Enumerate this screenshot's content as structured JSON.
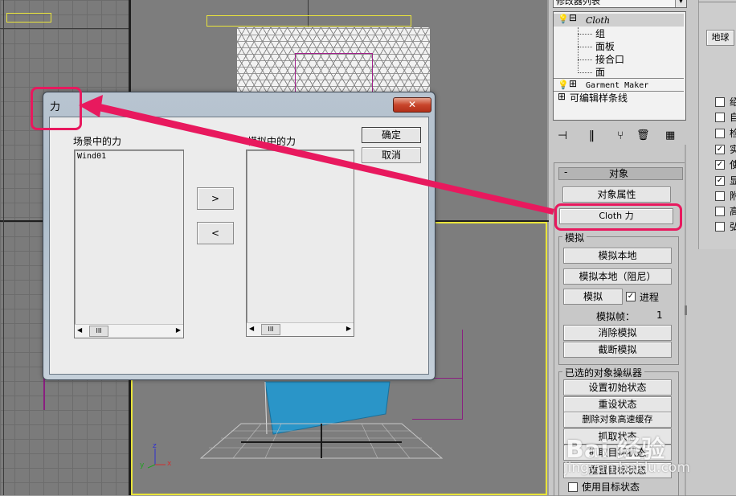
{
  "dialog": {
    "title": "力",
    "scene_forces_label": "场景中的力",
    "sim_forces_label": "模拟中的力",
    "scene_forces": [
      "Wind01"
    ],
    "add_label": ">",
    "remove_label": "<",
    "ok_label": "确定",
    "cancel_label": "取消",
    "close_glyph": "✕",
    "scroll_thumb": "III"
  },
  "panel": {
    "modifier_list": "修改器列表",
    "stack": [
      {
        "label": "Cloth",
        "level": 0,
        "expand": "⊟"
      },
      {
        "label": "组",
        "level": 1
      },
      {
        "label": "面板",
        "level": 1
      },
      {
        "label": "接合口",
        "level": 1
      },
      {
        "label": "面",
        "level": 1
      },
      {
        "label": "Garment Maker",
        "level": 0,
        "expand": "⊞"
      },
      {
        "label": "可编辑样条线",
        "level": 0,
        "expand": "⊞"
      }
    ],
    "rollout_title": "对象",
    "rollout_collapse": "-",
    "object_props": "对象属性",
    "cloth_forces": "Cloth 力",
    "sim_group": "模拟",
    "sim_local": "模拟本地",
    "sim_local_damped": "模拟本地（阻尼）",
    "simulate": "模拟",
    "progress": "进程",
    "sim_frame_label": "模拟帧：",
    "sim_frame_value": "1",
    "erase_sim": "消除模拟",
    "truncate_sim": "截断模拟",
    "selected_group": "已选的对象操纵器",
    "set_initial": "设置初始状态",
    "reset_state": "重设状态",
    "delete_cache": "删除对象高速缓存",
    "grab_state": "抓取状态",
    "grab_target": "抓取目标状态",
    "reset_target": "重置目标状态",
    "use_target": "使用目标状态",
    "far_right_button": "地球",
    "far_right_checks": [
      "绍",
      "自",
      "检",
      "实",
      "使",
      "显",
      "附",
      "高",
      "弘"
    ]
  },
  "watermark": {
    "brand": "Bai 经验",
    "url": "jingyan.baidu.com"
  },
  "axis_labels": {
    "x": "x",
    "y": "y",
    "z": "z"
  },
  "colors": {
    "highlight": "#e8195e",
    "viewport_border": "#e9e43b",
    "cloth_blue": "#2a95c8"
  }
}
